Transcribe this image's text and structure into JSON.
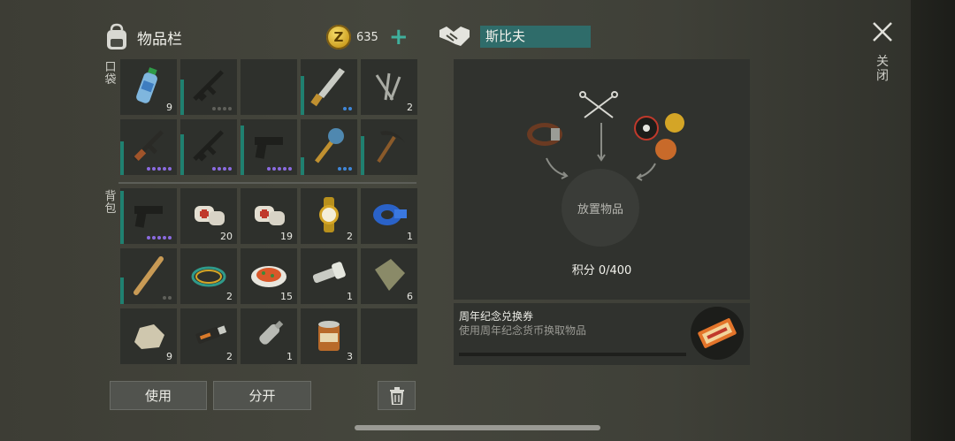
{
  "inventory": {
    "title": "物品栏",
    "icon": "backpack-icon",
    "coins": "635",
    "add_coins": "+",
    "coin_glyph": "Z",
    "pockets_label": "口袋",
    "backpack_label": "背包"
  },
  "slots": [
    {
      "icon": "water-bottle-icon",
      "count": "9"
    },
    {
      "icon": "assault-rifle-icon",
      "count": ""
    },
    {
      "icon": "empty-slot",
      "count": ""
    },
    {
      "icon": "machete-icon",
      "count": ""
    },
    {
      "icon": "nails-icon",
      "count": "2"
    },
    {
      "icon": "ak-rifle-icon",
      "count": ""
    },
    {
      "icon": "assault-rifle-icon",
      "count": ""
    },
    {
      "icon": "pistol-icon",
      "count": ""
    },
    {
      "icon": "spiked-club-icon",
      "count": ""
    },
    {
      "icon": "pickaxe-icon",
      "count": ""
    },
    {
      "icon": "pistol-icon",
      "count": ""
    },
    {
      "icon": "bandage-icon",
      "count": "20"
    },
    {
      "icon": "bandage-icon",
      "count": "19"
    },
    {
      "icon": "gold-watch-icon",
      "count": "2"
    },
    {
      "icon": "blue-tape-icon",
      "count": "1"
    },
    {
      "icon": "baseball-bat-icon",
      "count": ""
    },
    {
      "icon": "wire-icon",
      "count": "2"
    },
    {
      "icon": "food-plate-icon",
      "count": "15"
    },
    {
      "icon": "flashlight-icon",
      "count": "1"
    },
    {
      "icon": "cloth-icon",
      "count": "6"
    },
    {
      "icon": "stone-icon",
      "count": "9"
    },
    {
      "icon": "usb-drive-icon",
      "count": "2"
    },
    {
      "icon": "plastic-bottle-icon",
      "count": "1"
    },
    {
      "icon": "tin-can-icon",
      "count": "3"
    },
    {
      "icon": "empty-slot",
      "count": ""
    }
  ],
  "actions": {
    "use": "使用",
    "split": "分开",
    "delete_icon": "trash-icon"
  },
  "trader": {
    "name": "斯比夫",
    "icon": "handshake-icon"
  },
  "craft": {
    "place_item": "放置物品",
    "points": "积分 0/400"
  },
  "voucher": {
    "title": "周年纪念兑换券",
    "subtitle": "使用周年纪念货币换取物品",
    "progress": 0
  },
  "close": {
    "label": "关闭"
  },
  "colors": {
    "accent": "#2f6c6a",
    "durability": "#1f8070",
    "rarity_purple": "#8a6be0",
    "rarity_blue": "#3f86d8",
    "gold": "#d4a526"
  }
}
